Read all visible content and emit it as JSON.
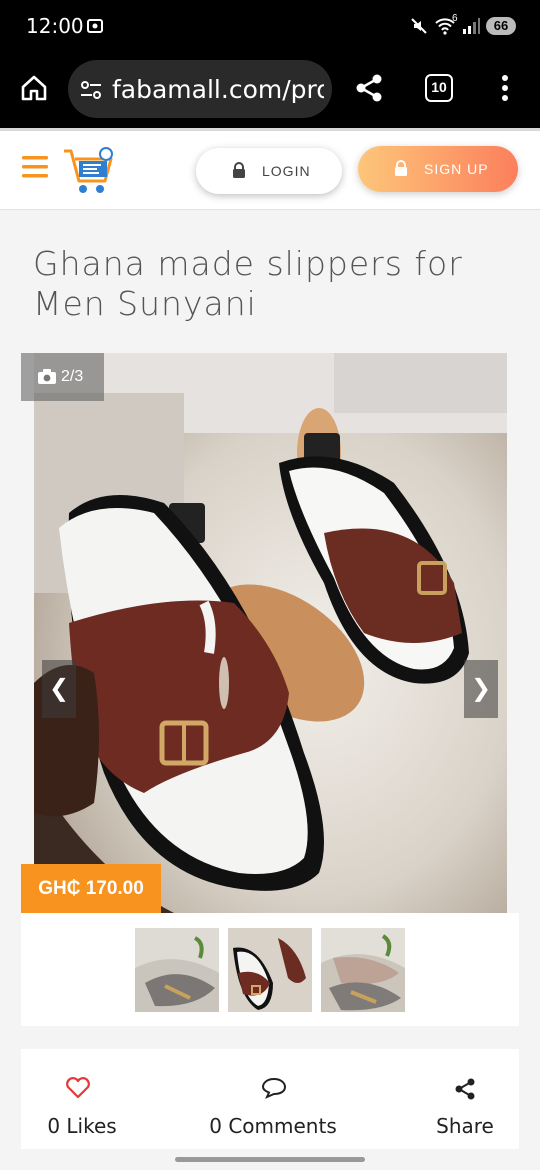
{
  "status_bar": {
    "time": "12:00",
    "battery": "66",
    "network_badge": "6"
  },
  "browser": {
    "url": "fabamall.com/prod",
    "tab_count": "10"
  },
  "header": {
    "login_label": "LOGIN",
    "signup_label": "SIGN UP"
  },
  "product": {
    "title": "Ghana made slippers for Men Sunyani",
    "photo_counter": "2/3",
    "price": "GH₵ 170.00",
    "prev_arrow": "❮",
    "next_arrow": "❯"
  },
  "social": {
    "likes_label": "0 Likes",
    "comments_label": "0 Comments",
    "share_label": "Share"
  },
  "colors": {
    "accent_orange": "#f7931e",
    "signup_gradient_start": "#fdc67a",
    "signup_gradient_end": "#fc7f5c",
    "like_red": "#e53935"
  }
}
